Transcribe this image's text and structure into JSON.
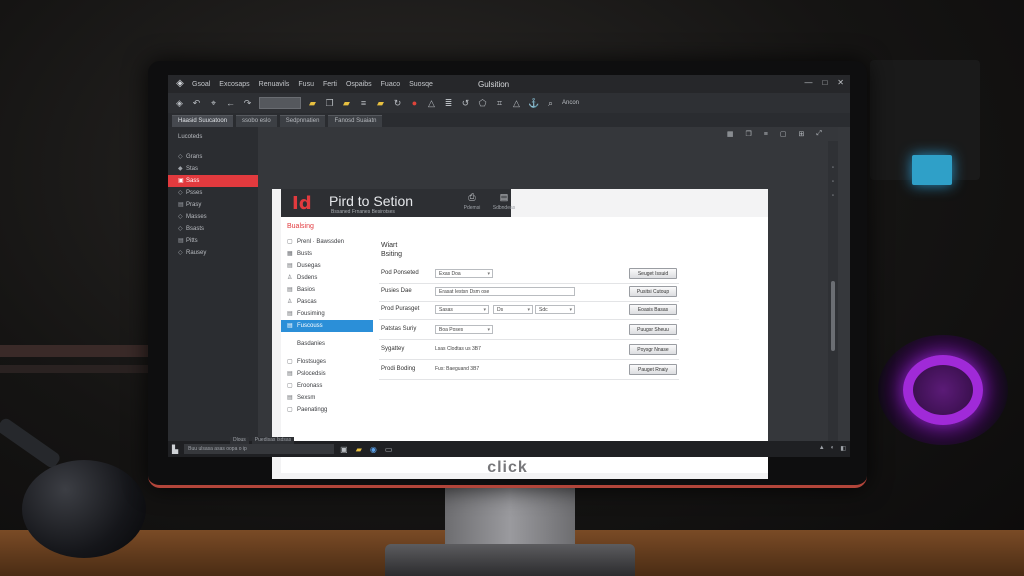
{
  "window": {
    "title": "Gulsition",
    "menu": [
      "Gsoal",
      "Excosaps",
      "Renuavils",
      "Fusu",
      "Ferti",
      "Ospaibs",
      "Fuaco",
      "Suosqe"
    ],
    "controls": [
      "—",
      "□",
      "✕"
    ]
  },
  "toolbar": {
    "tag_label": "Ancon"
  },
  "tabs": [
    "Haasid Suucatoon",
    "ssobo eslo",
    "Sedpnnatien",
    "Fanosd Suaiatn"
  ],
  "leftnav": {
    "header": "Lucoteds",
    "items": [
      {
        "label": "Grans",
        "icon": "◇"
      },
      {
        "label": "Stas",
        "icon": "◆"
      },
      {
        "label": "Sass",
        "icon": "▣",
        "active": true
      },
      {
        "label": "Psses",
        "icon": "◇"
      },
      {
        "label": "Prasy",
        "icon": "▤"
      },
      {
        "label": "Masses",
        "icon": "◇"
      },
      {
        "label": "Bsasts",
        "icon": "◇"
      },
      {
        "label": "Pitts",
        "icon": "▤"
      },
      {
        "label": "Rausey",
        "icon": "◇"
      }
    ]
  },
  "page": {
    "logo": "Id",
    "title": "Pird to Setion",
    "subtitle": "Bssaned Frnanes Besirotses",
    "tools": [
      {
        "label": "Pdemsi",
        "icon": "⎙"
      },
      {
        "label": "Sdbndeas",
        "icon": "▤"
      }
    ]
  },
  "sidebar": {
    "heading": "Bualsing",
    "items": [
      {
        "label": "Prenl · Bawssden",
        "icon": "▢"
      },
      {
        "label": "Busts",
        "icon": "▦"
      },
      {
        "label": "Dusegas",
        "icon": "▤"
      },
      {
        "label": "Dsdens",
        "icon": "♙"
      },
      {
        "label": "Basios",
        "icon": "▤"
      },
      {
        "label": "Pascas",
        "icon": "♙"
      },
      {
        "label": "Fousiming",
        "icon": "▤"
      },
      {
        "label": "Fuscouss",
        "icon": "▤",
        "active": true
      },
      {
        "label": "Basdanies",
        "icon": "",
        "gap_before": true
      },
      {
        "label": "Flostsuges",
        "icon": "▢",
        "gap_before": true
      },
      {
        "label": "Pslocedsis",
        "icon": "▤"
      },
      {
        "label": "Eroonass",
        "icon": "▢"
      },
      {
        "label": "Sexsm",
        "icon": "▤"
      },
      {
        "label": "Paenatingg",
        "icon": "▢"
      }
    ]
  },
  "form": {
    "title_line1": "Wiart",
    "title_line2": "Bsiting",
    "rows": [
      {
        "label": "Pod Ponseted",
        "field": "Exas Doa",
        "button": "Seuget Issuid"
      },
      {
        "label": "Pusies Dae",
        "field": "Erasat Iestsn Dsm ose",
        "button": "Pusitsi Cutoup"
      },
      {
        "label": "Prod Purasget",
        "fields": [
          "Sasas",
          "Ds",
          "Sdc"
        ],
        "button": "Eoasis Basas"
      },
      {
        "label": "Patstas Suriy",
        "field": "Boa Poses",
        "button": "Puugsr Sheuu"
      },
      {
        "label": "Sygattey",
        "text": "Lsas Clodtas us 3B7",
        "button": "Poysgr Nnase"
      },
      {
        "label": "Prodi Boding",
        "text": "Fus: Baeguand 3B7",
        "button": "Pauget Rnaiy"
      }
    ]
  },
  "taskbar": {
    "search_placeholder": "Buu ulsasa asas oopa o ip",
    "labels": [
      "Dlous",
      "Puedisas Isdsas"
    ],
    "tray": [
      "▲",
      "◐",
      "◧"
    ]
  },
  "monitor": {
    "brand": "click"
  }
}
